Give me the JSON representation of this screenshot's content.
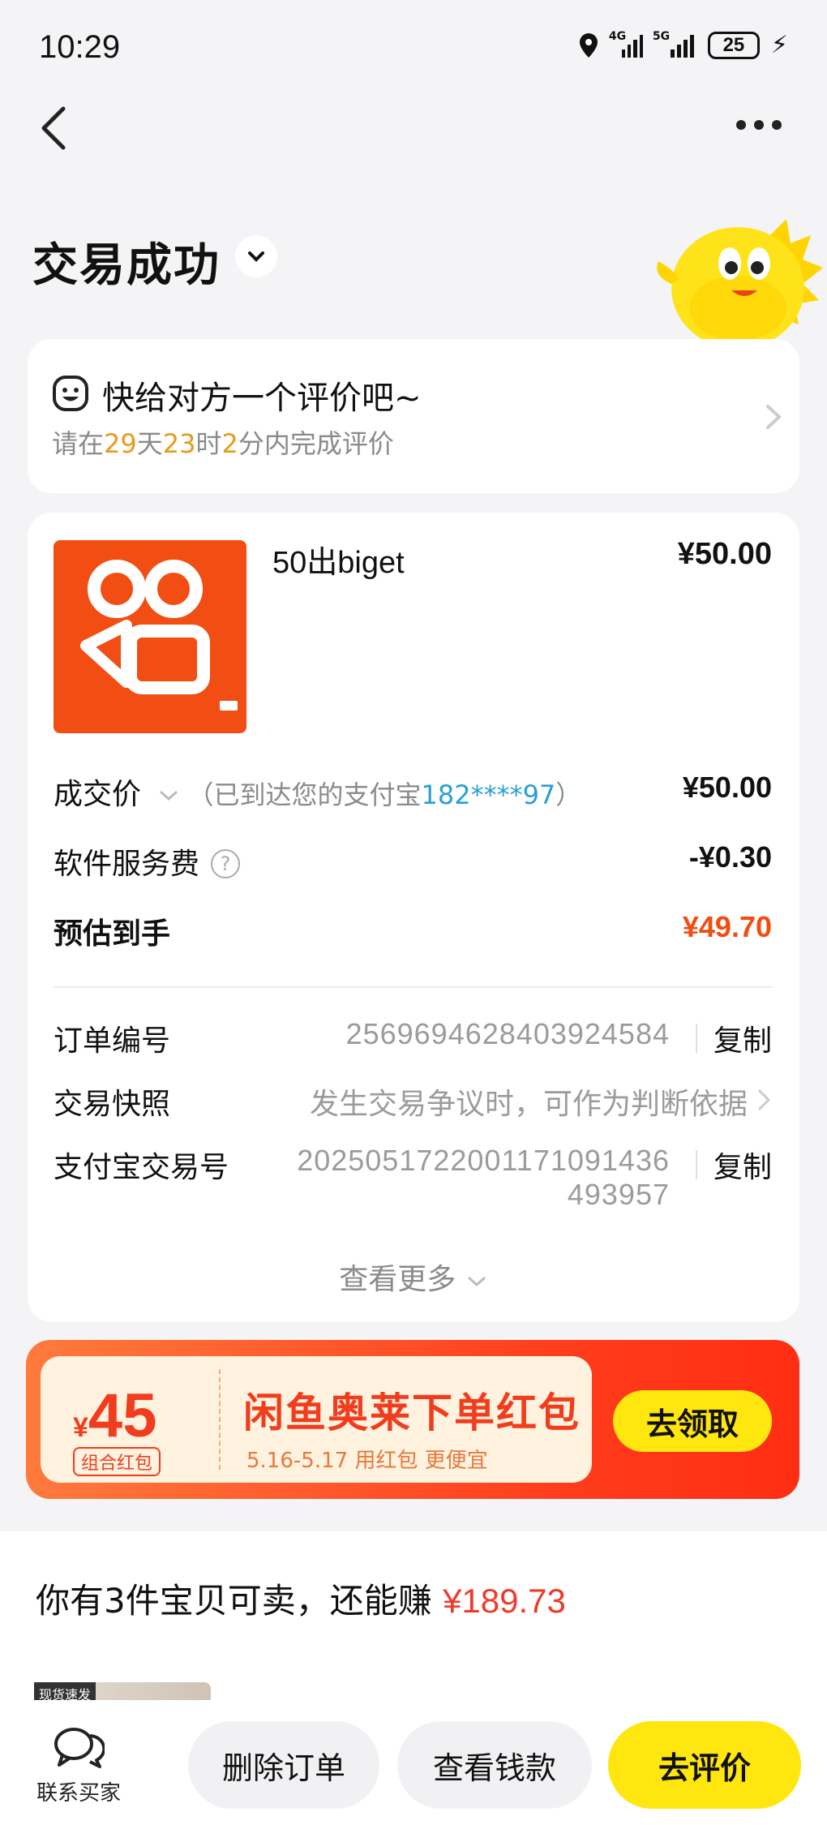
{
  "status_bar": {
    "time": "10:29",
    "net1": "4G",
    "net2": "5G",
    "battery": "25"
  },
  "header": {
    "title": "交易成功"
  },
  "review_card": {
    "title": "快给对方一个评价吧~",
    "sub_prefix": "请在",
    "days": "29",
    "unit_day": "天",
    "hours": "23",
    "unit_hour": "时",
    "minutes": "2",
    "sub_suffix": "分内完成评价"
  },
  "order": {
    "product_name": "50出biget",
    "product_price": "¥50.00",
    "deal_label": "成交价",
    "deal_note_prefix": "（已到达您的支付宝",
    "deal_account": "182****97",
    "deal_note_suffix": "）",
    "deal_price": "¥50.00",
    "fee_label": "软件服务费",
    "fee_value": "-¥0.30",
    "net_label": "预估到手",
    "net_value": "¥49.70",
    "order_no_label": "订单编号",
    "order_no": "2569694628403924584",
    "copy": "复制",
    "snapshot_label": "交易快照",
    "snapshot_value": "发生交易争议时，可作为判断依据",
    "alipay_no_label": "支付宝交易号",
    "alipay_no_line1": "2025051722001171091436",
    "alipay_no_line2": "493957",
    "see_more": "查看更多"
  },
  "banner": {
    "currency": "¥",
    "amount": "45",
    "tag": "组合红包",
    "title": "闲鱼奥莱下单红包",
    "sub": "5.16-5.17 用红包 更便宜",
    "button": "去领取"
  },
  "sell": {
    "prefix": "你有3件宝贝可卖，还能赚 ",
    "amount": "¥189.73",
    "thumb_tag": "现货速发"
  },
  "bottom_bar": {
    "contact": "联系买家",
    "delete": "删除订单",
    "view_money": "查看钱款",
    "review": "去评价"
  },
  "colors": {
    "accent_yellow": "#ffe60f",
    "price_red": "#ef3a2a",
    "countdown_orange": "#e89a1c",
    "link_blue": "#2a9fd6"
  }
}
